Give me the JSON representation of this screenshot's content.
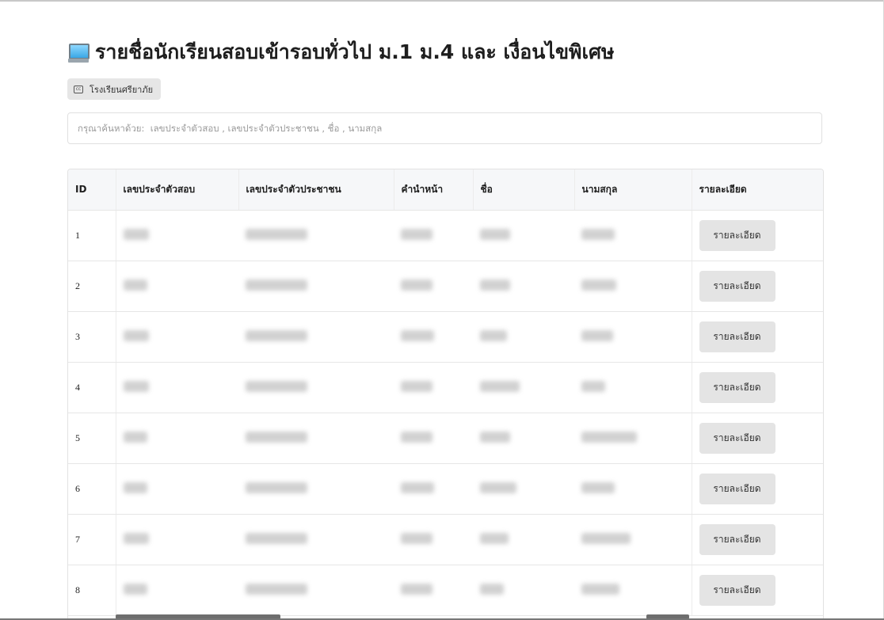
{
  "page": {
    "title": "รายชื่อนักเรียนสอบเข้ารอบทั่วไป ม.1 ม.4 และ เงื่อนไขพิเศษ",
    "title_icon": "desktop-computer-icon",
    "school_badge": "โรงเรียนศรียาภัย",
    "badge_icon": "cc-icon"
  },
  "search": {
    "placeholder": "กรุณาค้นหาด้วย:  เลขประจำตัวสอบ , เลขประจำตัวประชาชน , ชื่อ , นามสกุล",
    "value": ""
  },
  "table": {
    "columns": [
      "ID",
      "เลขประจำตัวสอบ",
      "เลขประจำตัวประชาชน",
      "คำนำหน้า",
      "ชื่อ",
      "นามสกุล",
      "รายละเอียด"
    ],
    "rows": [
      {
        "id": "1",
        "detail_label": "รายละเอียด"
      },
      {
        "id": "2",
        "detail_label": "รายละเอียด"
      },
      {
        "id": "3",
        "detail_label": "รายละเอียด"
      },
      {
        "id": "4",
        "detail_label": "รายละเอียด"
      },
      {
        "id": "5",
        "detail_label": "รายละเอียด"
      },
      {
        "id": "6",
        "detail_label": "รายละเอียด"
      },
      {
        "id": "7",
        "detail_label": "รายละเอียด"
      },
      {
        "id": "8",
        "detail_label": "รายละเอียด"
      }
    ]
  },
  "colors": {
    "header_bg": "#f6f7f9",
    "button_bg": "#e4e4e4",
    "border": "#e2e2e2"
  }
}
